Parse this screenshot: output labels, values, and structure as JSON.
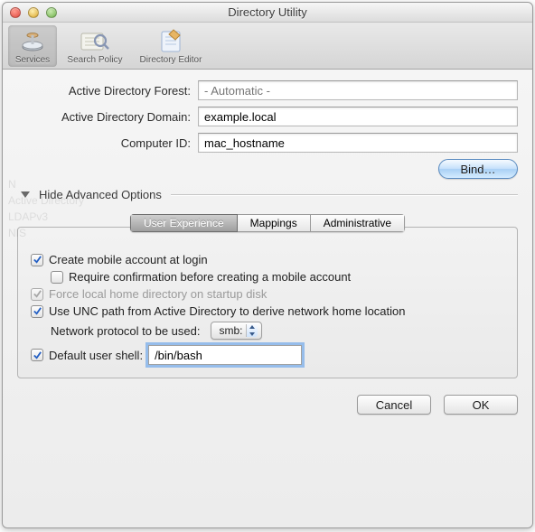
{
  "window": {
    "title": "Directory Utility"
  },
  "toolbar": {
    "items": [
      {
        "label": "Services"
      },
      {
        "label": "Search Policy"
      },
      {
        "label": "Directory Editor"
      }
    ]
  },
  "form": {
    "forest_label": "Active Directory Forest:",
    "forest_placeholder": "- Automatic -",
    "domain_label": "Active Directory Domain:",
    "domain_value": "example.local",
    "computer_label": "Computer ID:",
    "computer_value": "mac_hostname",
    "bind_button": "Bind…"
  },
  "disclosure": {
    "label": "Hide Advanced Options"
  },
  "tabs": {
    "items": [
      "User Experience",
      "Mappings",
      "Administrative"
    ]
  },
  "options": {
    "create_mobile": "Create mobile account at login",
    "require_confirm": "Require confirmation before creating a mobile account",
    "force_local": "Force local home directory on startup disk",
    "use_unc": "Use UNC path from Active Directory to derive network home location",
    "net_proto_label": "Network protocol to be used:",
    "net_proto_value": "smb:",
    "default_shell": "Default user shell:",
    "shell_value": "/bin/bash"
  },
  "footer": {
    "cancel": "Cancel",
    "ok": "OK"
  },
  "ghost": {
    "l1": "N",
    "l2": "Active Directory",
    "l3": "LDAPv3",
    "l4": "NIS"
  }
}
